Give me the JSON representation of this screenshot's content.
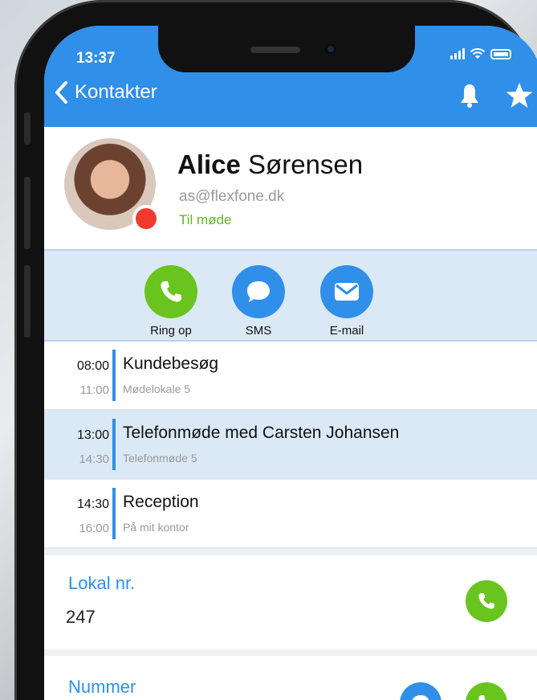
{
  "status_bar": {
    "time": "13:37"
  },
  "nav": {
    "back_label": "Kontakter"
  },
  "contact": {
    "first_name": "Alice",
    "last_name": "Sørensen",
    "email": "as@flexfone.dk",
    "status": "Til møde"
  },
  "actions": [
    {
      "label": "Ring op",
      "icon": "phone-icon"
    },
    {
      "label": "SMS",
      "icon": "chat-bubble-icon"
    },
    {
      "label": "E-mail",
      "icon": "envelope-icon"
    }
  ],
  "events": [
    {
      "start": "08:00",
      "end": "11:00",
      "title": "Kundebesøg",
      "location": "Mødelokale 5"
    },
    {
      "start": "13:00",
      "end": "14:30",
      "title": "Telefonmøde med Carsten Johansen",
      "location": "Telefonmøde 5"
    },
    {
      "start": "14:30",
      "end": "16:00",
      "title": "Reception",
      "location": "På mit kontor"
    }
  ],
  "fields": {
    "local": {
      "label": "Lokal nr.",
      "value": "247"
    },
    "number": {
      "label": "Nummer"
    }
  },
  "colors": {
    "header": "#2f8fe9",
    "call": "#69c41e",
    "busy": "#f03a2e",
    "highlight": "#dbe8f6"
  }
}
